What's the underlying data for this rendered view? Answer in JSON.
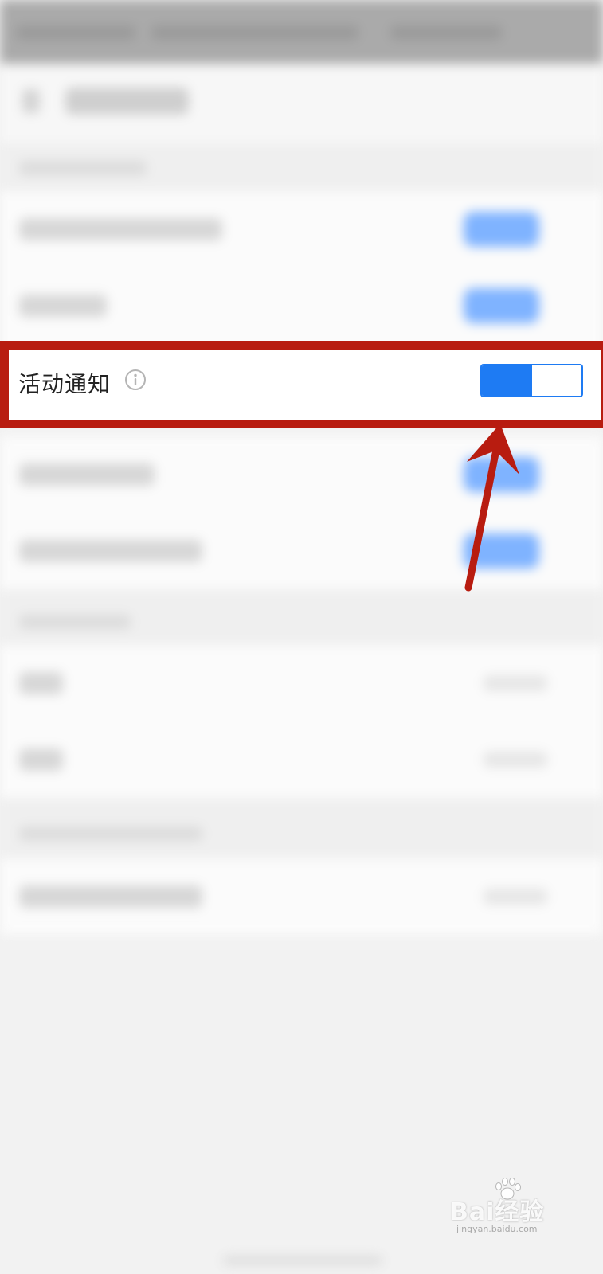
{
  "focused_row": {
    "label": "活动通知",
    "info_icon": "info-circle-icon",
    "toggle_on": true,
    "toggle_fill_fraction": 0.5
  },
  "annotation": {
    "frame_color": "#b81c10",
    "arrow_color": "#b81c10"
  },
  "colors": {
    "toggle_accent": "#1e7bf3"
  },
  "watermark": {
    "brand": "Bai经验",
    "site": "jingyan.baidu.com"
  }
}
